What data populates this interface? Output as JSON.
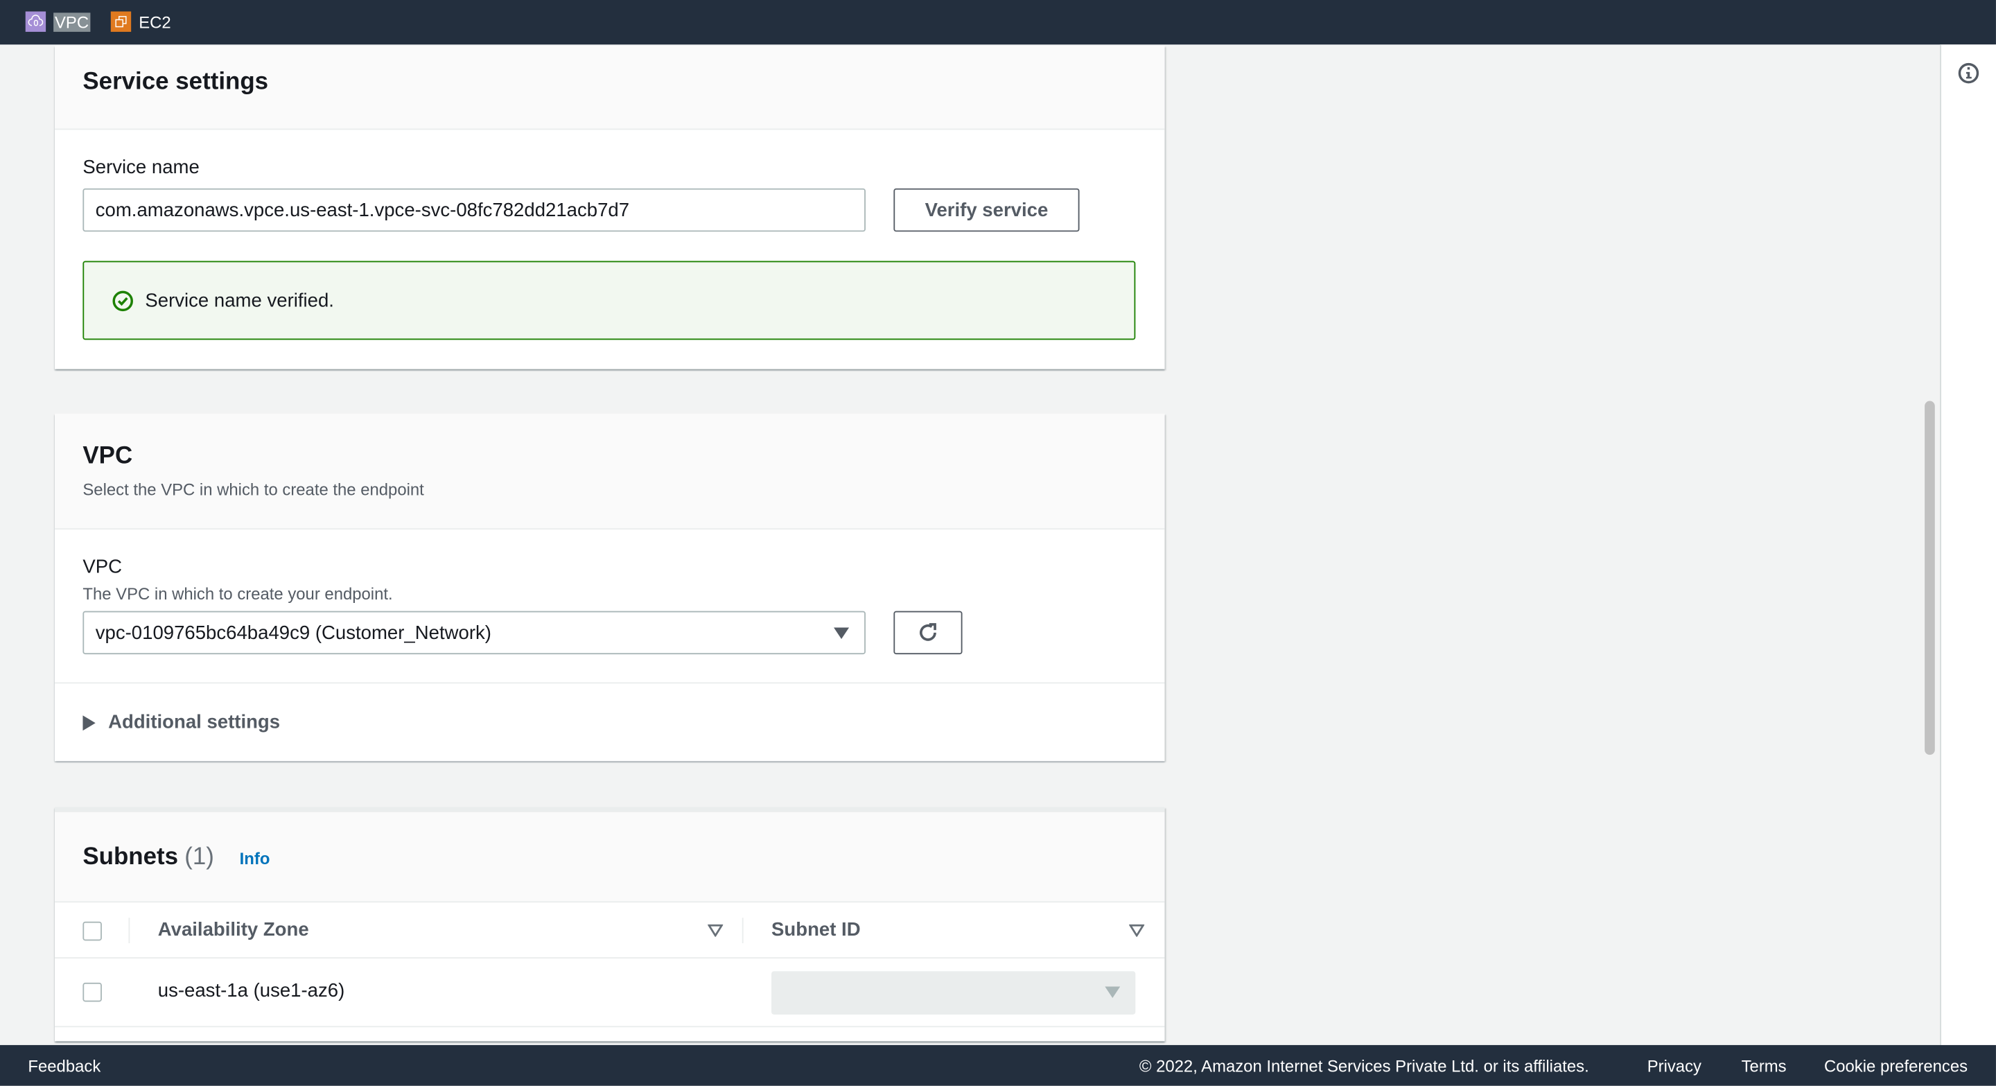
{
  "topbar": {
    "services": [
      {
        "label": "VPC",
        "icon": "vpc-icon",
        "color": "#a166ff"
      },
      {
        "label": "EC2",
        "icon": "ec2-icon",
        "color": "#e07a1f"
      }
    ]
  },
  "service_settings": {
    "title": "Service settings",
    "service_name_label": "Service name",
    "service_name_value": "com.amazonaws.vpce.us-east-1.vpce-svc-08fc782dd21acb7d7",
    "verify_button": "Verify service",
    "alert": {
      "type": "success",
      "text": "Service name verified.",
      "color": "#1d8102"
    }
  },
  "vpc": {
    "title": "VPC",
    "description": "Select the VPC in which to create the endpoint",
    "field_label": "VPC",
    "field_description": "The VPC in which to create your endpoint.",
    "selected": "vpc-0109765bc64ba49c9 (Customer_Network)",
    "additional_settings": "Additional settings"
  },
  "subnets": {
    "title": "Subnets",
    "count": "(1)",
    "info": "Info",
    "columns": [
      "Availability Zone",
      "Subnet ID"
    ],
    "rows": [
      {
        "az": "us-east-1a (use1-az6)",
        "subnet_id": ""
      }
    ]
  },
  "footer": {
    "feedback": "Feedback",
    "copyright": "© 2022, Amazon Internet Services Private Ltd. or its affiliates.",
    "links": [
      "Privacy",
      "Terms",
      "Cookie preferences"
    ]
  }
}
